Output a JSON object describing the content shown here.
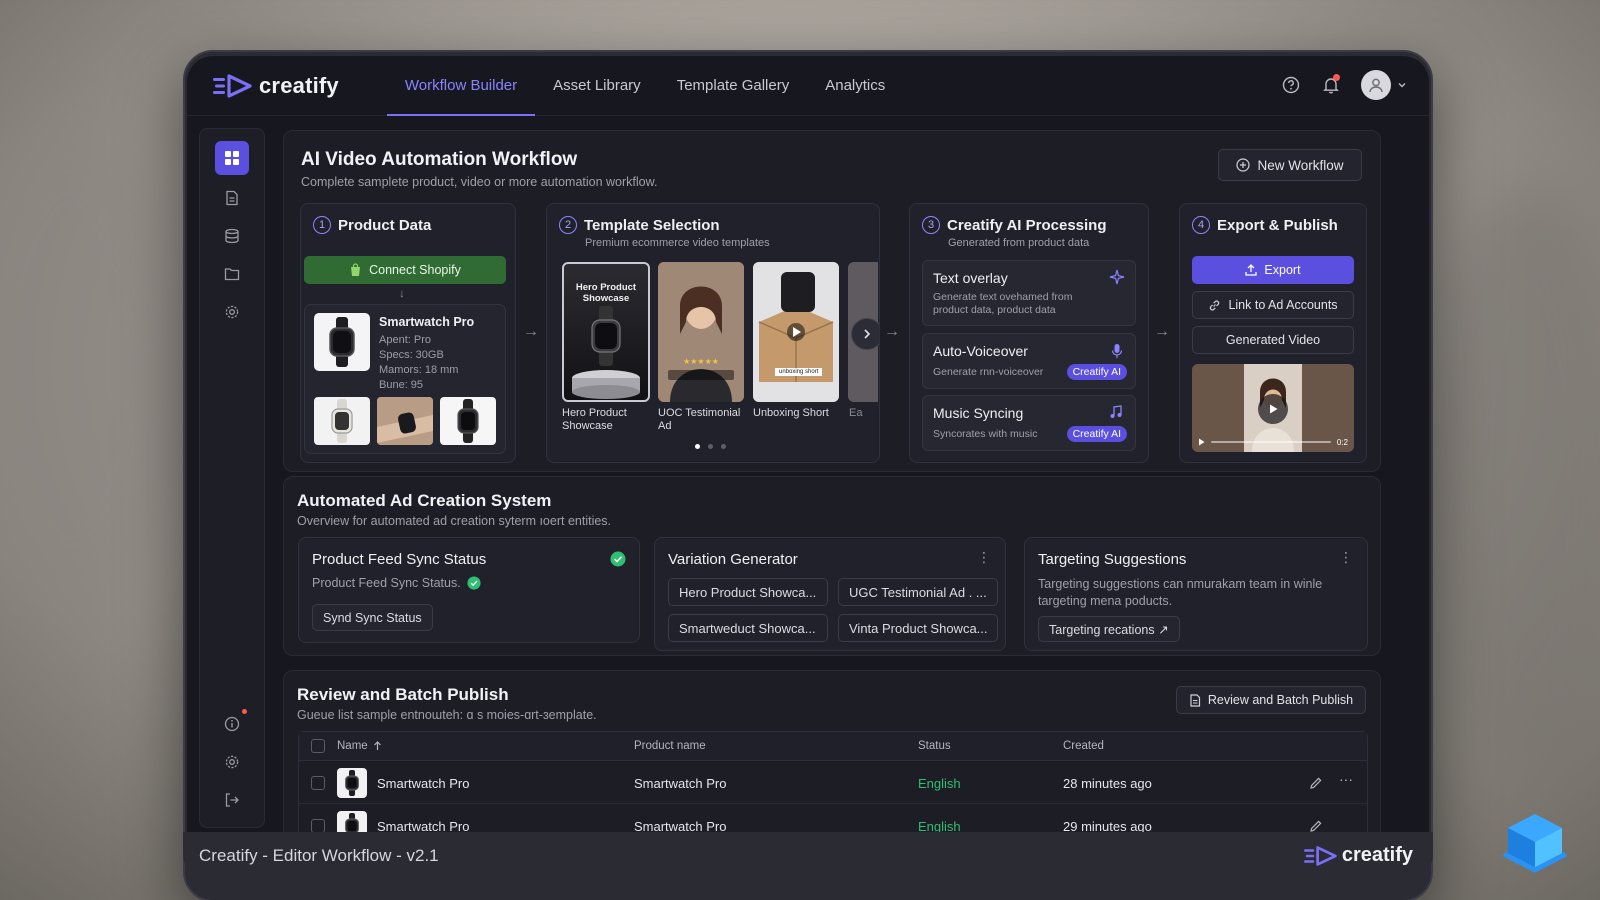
{
  "app": {
    "name": "creatify"
  },
  "nav": {
    "tabs": [
      {
        "label": "Workflow Builder",
        "active": true
      },
      {
        "label": "Asset Library"
      },
      {
        "label": "Template Gallery"
      },
      {
        "label": "Analytics"
      }
    ]
  },
  "workflow": {
    "title": "AI Video Automation Workflow",
    "subtitle": "Complete samplete product, video or more automation workflow.",
    "new_button": "New Workflow",
    "step1": {
      "num": "1",
      "title": "Product Data",
      "connect_button": "Connect Shopify",
      "product": {
        "name": "Smartwatch Pro",
        "line1": "Apent: Pro",
        "line2": "Specs: 30GB",
        "line3": "Mamors: 18 mm",
        "line4": "Bune: 95"
      }
    },
    "step2": {
      "num": "2",
      "title": "Template Selection",
      "subtitle": "Premium ecommerce video templates",
      "templates": [
        {
          "label": "Hero Product Showcase",
          "overlay": "Hero Product Showcase"
        },
        {
          "label": "UOC Testimonial Ad"
        },
        {
          "label": "Unboxing Short",
          "tag": "unboxing short"
        },
        {
          "label": "Ea"
        }
      ]
    },
    "step3": {
      "num": "3",
      "title": "Creatify AI Processing",
      "subtitle": "Generated from product data",
      "items": [
        {
          "title": "Text overlay",
          "desc": "Generate text ovehamed from product data, product data"
        },
        {
          "title": "Auto-Voiceover",
          "desc": "Generate rnn-voiceover",
          "badge": "Creatify AI"
        },
        {
          "title": "Music Syncing",
          "desc": "Syncorates with music",
          "badge": "Creatify AI"
        }
      ]
    },
    "step4": {
      "num": "4",
      "title": "Export & Publish",
      "export_button": "Export",
      "link_button": "Link to Ad Accounts",
      "generated_button": "Generated Video",
      "video_time": "0:2"
    }
  },
  "ads": {
    "title": "Automated Ad Creation System",
    "subtitle": "Overview for automated ad creation syterm ıoert entities.",
    "feed": {
      "title": "Product Feed Sync Status",
      "status_text": "Product Feed Sync Status.",
      "button": "Synd Sync Status"
    },
    "variation": {
      "title": "Variation Generator",
      "chips": [
        "Hero Product Showca...",
        "UGC Testimonial Ad . ...",
        "Smartweduct Showca...",
        "Vinta Product Showca..."
      ]
    },
    "targeting": {
      "title": "Targeting Suggestions",
      "desc": "Targeting suggestions can nmurakam team in winle targeting mena poducts.",
      "button": "Targeting recations ↗"
    }
  },
  "review": {
    "title": "Review and Batch Publish",
    "subtitle": "Gueue list sample entnoɯteh: ɑ s moies-ɑrt-ɜemplate.",
    "button": "Review and Batch Publish",
    "columns": [
      "Name",
      "Product name",
      "Status",
      "Created"
    ],
    "rows": [
      {
        "name": "Smartwatch Pro",
        "product": "Smartwatch Pro",
        "status": "English",
        "created": "28 minutes ago"
      },
      {
        "name": "Smartwatch Pro",
        "product": "Smartwatch Pro",
        "status": "English",
        "created": "29 minutes ago"
      }
    ]
  },
  "footer": {
    "caption": "Creatify - Editor Workflow - v2.1",
    "brand": "creatify"
  },
  "colors": {
    "accent": "#5b4fe0",
    "accent_text": "#8b82ff",
    "success": "#2fbf71",
    "shopify": "#2f6b32"
  }
}
